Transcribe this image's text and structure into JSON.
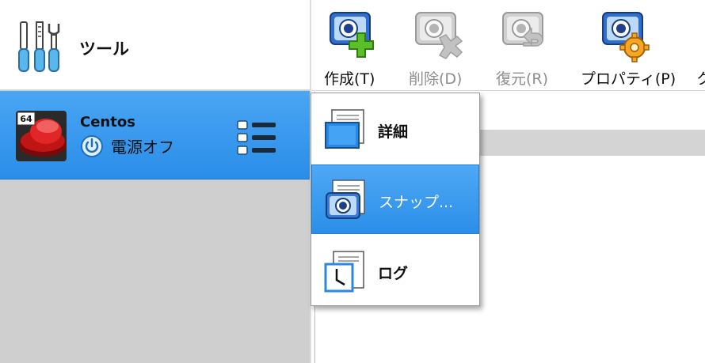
{
  "sidebar": {
    "tools_label": "ツール",
    "vm": {
      "os_badge": "64",
      "name": "Centos",
      "state": "電源オフ"
    }
  },
  "toolbar": {
    "buttons": [
      {
        "label": "作成(T)",
        "icon": "create-icon",
        "enabled": true
      },
      {
        "label": "削除(D)",
        "icon": "remove-icon",
        "enabled": false
      },
      {
        "label": "復元(R)",
        "icon": "restore-icon",
        "enabled": false
      },
      {
        "label": "プロパティ(P)",
        "icon": "properties-icon",
        "enabled": true
      },
      {
        "label": "ク",
        "icon": "clone-icon",
        "enabled": true
      }
    ]
  },
  "popup_menu": {
    "items": [
      {
        "label": "詳細",
        "icon": "details-icon",
        "selected": false
      },
      {
        "label": "スナップ...",
        "icon": "snapshot-icon",
        "selected": true
      },
      {
        "label": "ログ",
        "icon": "log-icon",
        "selected": false
      }
    ]
  },
  "colors": {
    "selection": "#2b8ee8",
    "sidebar_bg": "#cfcfcf",
    "accent_green": "#5bbf2a"
  }
}
